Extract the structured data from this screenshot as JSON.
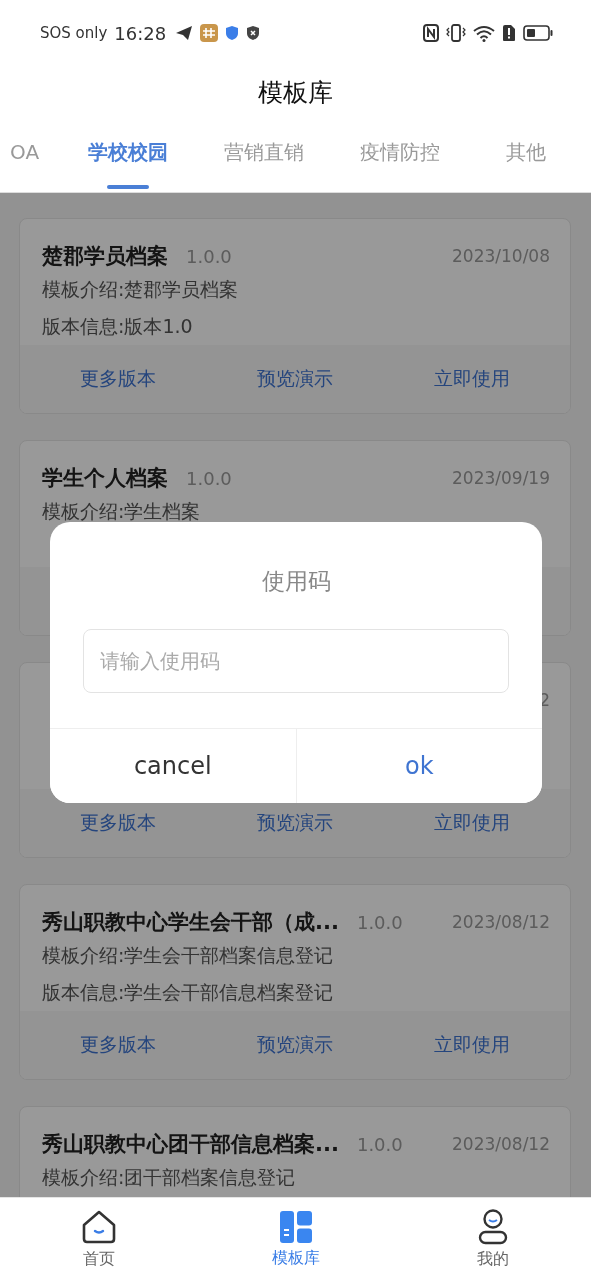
{
  "status_bar": {
    "carrier": "SOS only",
    "time": "16:28"
  },
  "header": {
    "title": "模板库"
  },
  "tabs": [
    {
      "label": "OA",
      "selected": false
    },
    {
      "label": "学校校园",
      "selected": true
    },
    {
      "label": "营销直销",
      "selected": false
    },
    {
      "label": "疫情防控",
      "selected": false
    },
    {
      "label": "其他",
      "selected": false
    }
  ],
  "cards": [
    {
      "title": "楚郡学员档案",
      "version": "1.0.0",
      "date": "2023/10/08",
      "intro": "模板介绍:楚郡学员档案",
      "version_info": "版本信息:版本1.0",
      "actions": [
        "更多版本",
        "预览演示",
        "立即使用"
      ]
    },
    {
      "title": "学生个人档案",
      "version": "1.0.0",
      "date": "2023/09/19",
      "intro": "模板介绍:学生档案"
    },
    {
      "date": "2",
      "actions": [
        "更多版本",
        "预览演示",
        "立即使用"
      ]
    },
    {
      "title": "秀山职教中心学生会干部（成...",
      "version": "1.0.0",
      "date": "2023/08/12",
      "intro": "模板介绍:学生会干部档案信息登记",
      "version_info": "版本信息:学生会干部信息档案登记",
      "actions": [
        "更多版本",
        "预览演示",
        "立即使用"
      ]
    },
    {
      "title": "秀山职教中心团干部信息档案...",
      "version": "1.0.0",
      "date": "2023/08/12",
      "intro": "模板介绍:团干部档案信息登记"
    }
  ],
  "dialog": {
    "title": "使用码",
    "placeholder": "请输入使用码",
    "buttons": [
      {
        "label": "cancel",
        "kind": "cancel"
      },
      {
        "label": "ok",
        "kind": "confirm"
      }
    ]
  },
  "bottom_nav": [
    {
      "label": "首页",
      "kind": "home",
      "selected": false
    },
    {
      "label": "模板库",
      "kind": "templates",
      "selected": true
    },
    {
      "label": "我的",
      "kind": "profile",
      "selected": false
    }
  ]
}
